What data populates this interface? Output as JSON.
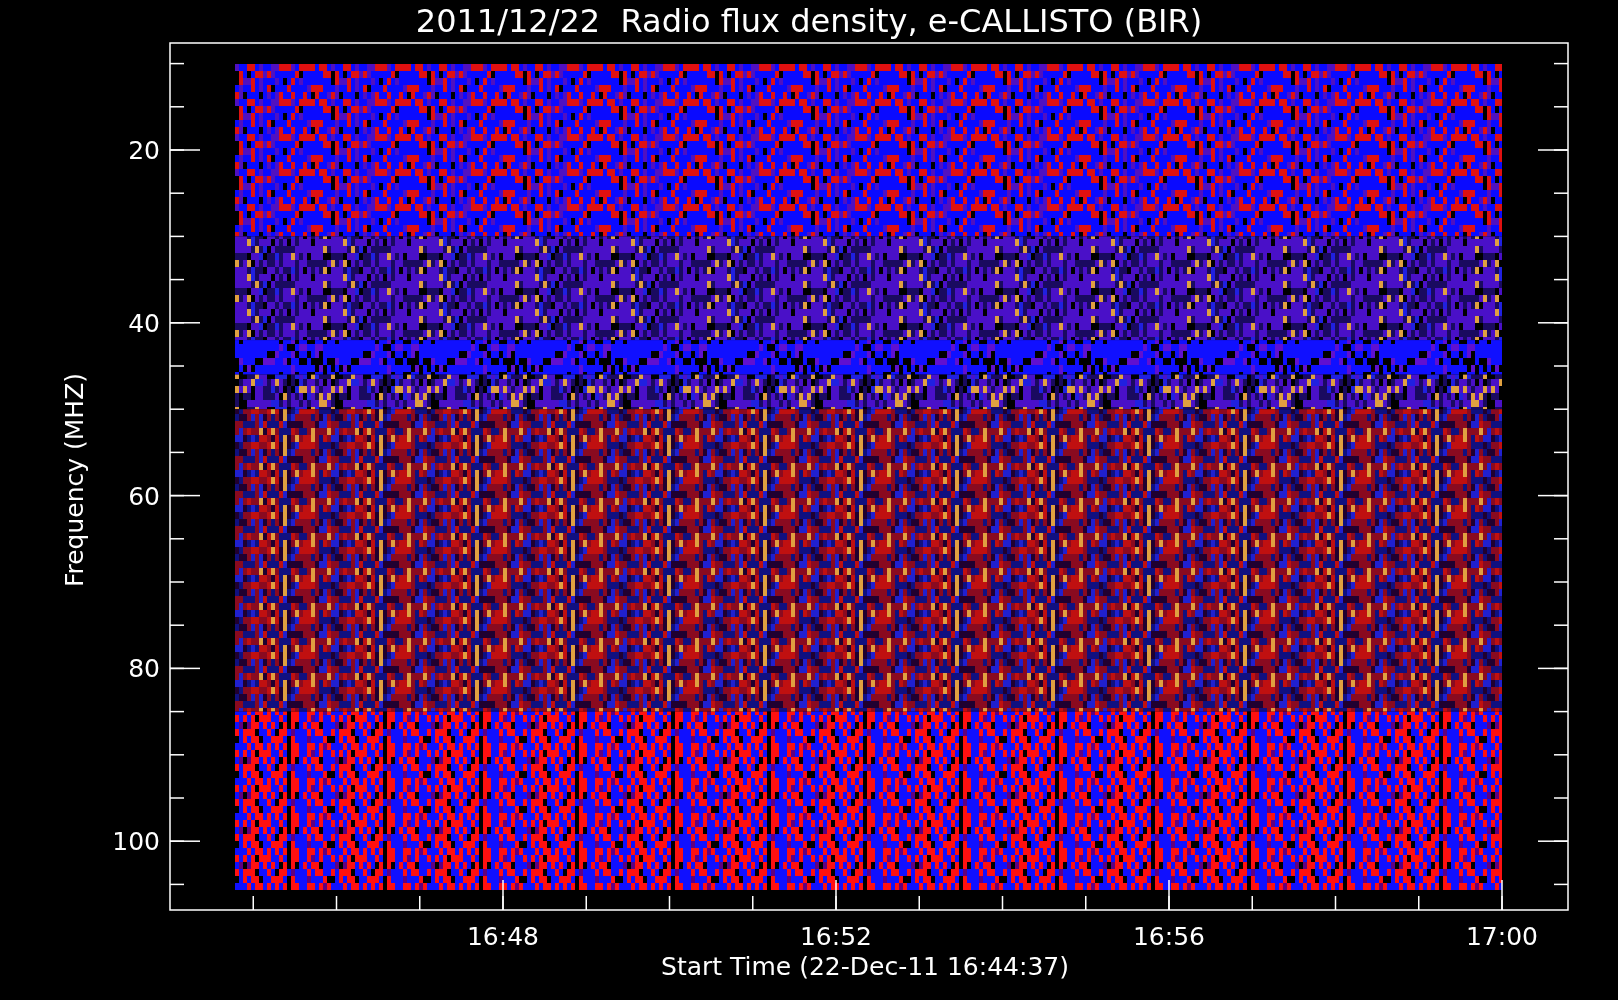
{
  "title": "2011/12/22  Radio flux density, e-CALLISTO (BIR)",
  "y_axis": {
    "label": "Frequency (MHZ)",
    "ticks": [
      "20",
      "40",
      "60",
      "80",
      "100"
    ]
  },
  "x_axis": {
    "label": "Start Time (22-Dec-11 16:44:37)",
    "ticks": [
      "16:48",
      "16:52",
      "16:56",
      "17:00"
    ]
  }
}
